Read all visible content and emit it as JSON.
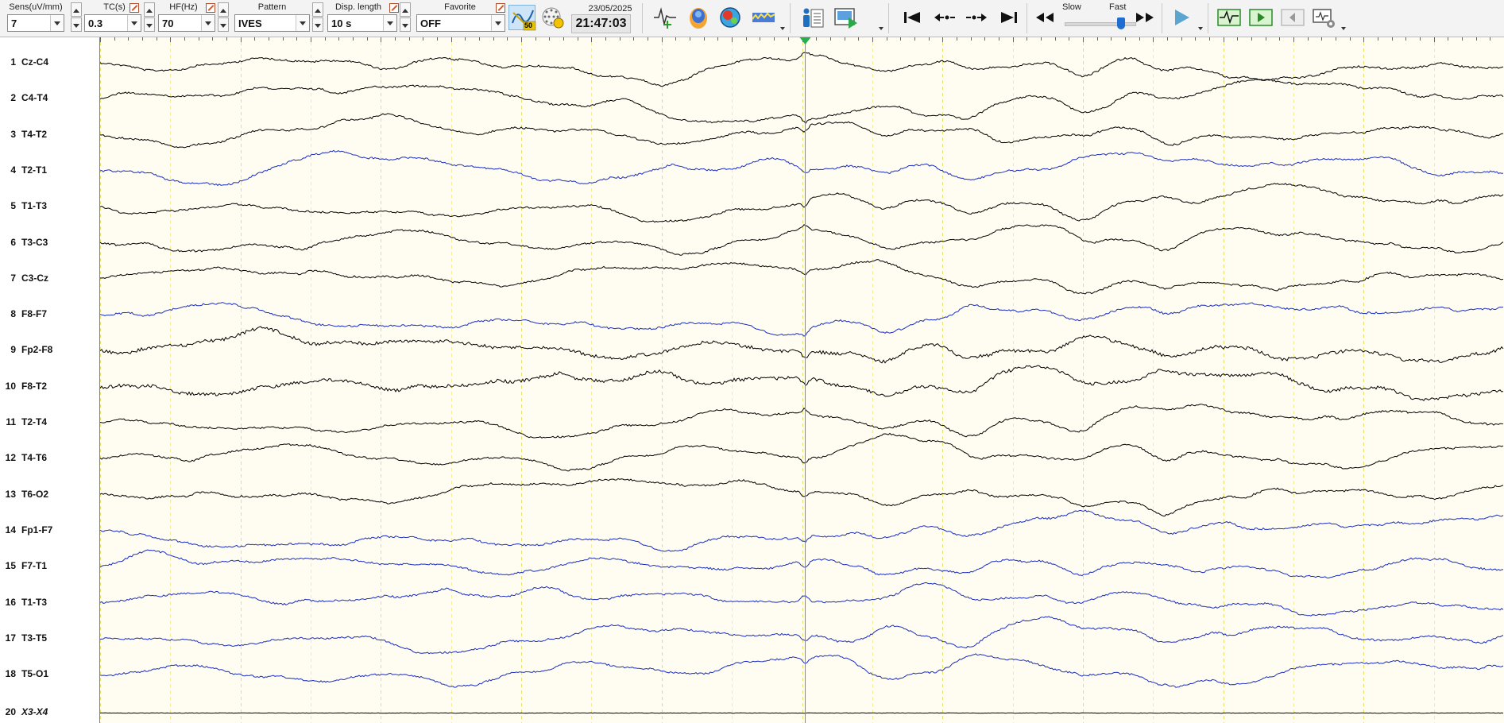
{
  "toolbar": {
    "sens": {
      "label": "Sens(uV/mm)",
      "value": "7"
    },
    "tc": {
      "label": "TC(s)",
      "value": "0.3"
    },
    "hf": {
      "label": "HF(Hz)",
      "value": "70"
    },
    "pattern": {
      "label": "Pattern",
      "value": "IVES"
    },
    "disp_length": {
      "label": "Disp. length",
      "value": "10 s"
    },
    "favorite": {
      "label": "Favorite",
      "value": "OFF"
    },
    "notch_badge": "50",
    "date": "23/05/2025",
    "time": "21:47:03",
    "speed": {
      "slow": "Slow",
      "fast": "Fast",
      "level": 0.85
    },
    "icons": [
      "notch-filter-icon",
      "montage-grid-icon",
      "waveform-marker-icon",
      "head-map-icon",
      "topographic-map-icon",
      "spectrum-icon",
      "patient-info-icon",
      "video-icon",
      "skip-to-start-icon",
      "step-back-icon",
      "step-forward-icon",
      "skip-to-end-icon",
      "rewind-icon",
      "fast-forward-icon",
      "play-icon",
      "signal-view-icon",
      "review-icon",
      "back-icon",
      "settings-tools-icon"
    ]
  },
  "channels": [
    {
      "num": "1",
      "name": "Cz-C4",
      "color": "#000000"
    },
    {
      "num": "2",
      "name": "C4-T4",
      "color": "#000000"
    },
    {
      "num": "3",
      "name": "T4-T2",
      "color": "#000000"
    },
    {
      "num": "4",
      "name": "T2-T1",
      "color": "#1a2dbf"
    },
    {
      "num": "5",
      "name": "T1-T3",
      "color": "#000000"
    },
    {
      "num": "6",
      "name": "T3-C3",
      "color": "#000000"
    },
    {
      "num": "7",
      "name": "C3-Cz",
      "color": "#000000"
    },
    {
      "num": "8",
      "name": "F8-F7",
      "color": "#1a2dbf"
    },
    {
      "num": "9",
      "name": "Fp2-F8",
      "color": "#000000"
    },
    {
      "num": "10",
      "name": "F8-T2",
      "color": "#000000"
    },
    {
      "num": "11",
      "name": "T2-T4",
      "color": "#000000"
    },
    {
      "num": "12",
      "name": "T4-T6",
      "color": "#000000"
    },
    {
      "num": "13",
      "name": "T6-O2",
      "color": "#000000"
    },
    {
      "num": "14",
      "name": "Fp1-F7",
      "color": "#1a2dbf"
    },
    {
      "num": "15",
      "name": "F7-T1",
      "color": "#1a2dbf"
    },
    {
      "num": "16",
      "name": "T1-T3",
      "color": "#1a2dbf"
    },
    {
      "num": "17",
      "name": "T3-T5",
      "color": "#1a2dbf"
    },
    {
      "num": "18",
      "name": "T5-O1",
      "color": "#1a2dbf"
    },
    {
      "num": "20",
      "name": "X3-X4",
      "color": "#000000",
      "italic": true
    }
  ],
  "colors": {
    "trace_background": "#fffdf2",
    "second_gridline": "#e7e16a",
    "half_second_gridline": "#f1ec9c",
    "cursor_line": "#8c8c8c",
    "event_marker": "#22b14c",
    "blue_trace": "#1a2dbf",
    "black_trace": "#000000"
  }
}
